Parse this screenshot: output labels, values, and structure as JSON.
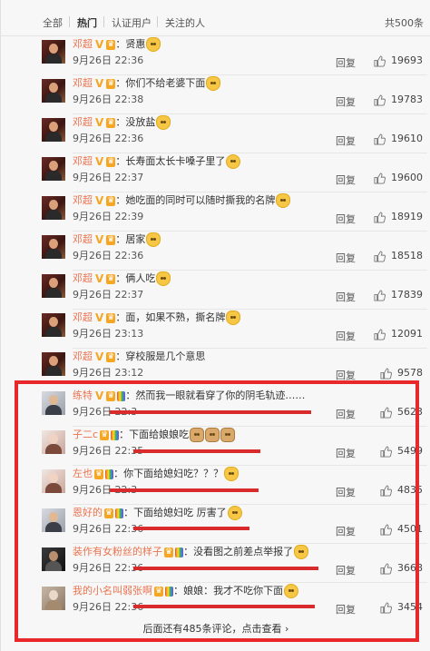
{
  "tabs": {
    "all": "全部",
    "hot": "热门",
    "verified": "认证用户",
    "following": "关注的人",
    "total": "共500条"
  },
  "comments": [
    {
      "user": "邓超",
      "text": "：贤惠",
      "date": "9月26日 22:36",
      "reply": "回复",
      "likes": "19693"
    },
    {
      "user": "邓超",
      "text": "：你们不给老婆下面",
      "date": "9月26日 22:38",
      "reply": "回复",
      "likes": "19783"
    },
    {
      "user": "邓超",
      "text": "：没放盐",
      "date": "9月26日 22:36",
      "reply": "回复",
      "likes": "19610"
    },
    {
      "user": "邓超",
      "text": "：长寿面太长卡嗓子里了",
      "date": "9月26日 22:37",
      "reply": "回复",
      "likes": "19600"
    },
    {
      "user": "邓超",
      "text": "：她吃面的同时可以随时撕我的名牌",
      "date": "9月26日 22:39",
      "reply": "回复",
      "likes": "18919"
    },
    {
      "user": "邓超",
      "text": "：居家",
      "date": "9月26日 22:36",
      "reply": "回复",
      "likes": "18518"
    },
    {
      "user": "邓超",
      "text": "：俩人吃",
      "date": "9月26日 22:37",
      "reply": "回复",
      "likes": "17839"
    },
    {
      "user": "邓超",
      "text": "：面，如果不熟，撕名牌",
      "date": "9月26日 23:13",
      "reply": "回复",
      "likes": "12091"
    },
    {
      "user": "邓超",
      "text": "：穿校服是几个意思",
      "date": "9月26日 23:12",
      "reply": "回复",
      "likes": "9578"
    },
    {
      "user": "练特",
      "text": "：然而我一眼就看穿了你的阴毛轨迹……",
      "date": "9月26日 22:3",
      "reply": "回复",
      "likes": "5623"
    },
    {
      "user": "子二c",
      "text": "：下面给娘娘吃",
      "date": "9月26日 22:35",
      "reply": "回复",
      "likes": "5499"
    },
    {
      "user": "左也",
      "text": "：你下面给媳妇吃？？？",
      "date": "9月26日 22:3",
      "reply": "回复",
      "likes": "4835"
    },
    {
      "user": "恩好的",
      "text": "：下面给媳妇吃 厉害了",
      "date": "9月26日 22:36",
      "reply": "回复",
      "likes": "4501"
    },
    {
      "user": "装作有女粉丝的样子",
      "text": "：没看图之前差点举报了",
      "date": "9月26日 22:36",
      "reply": "回复",
      "likes": "3668"
    },
    {
      "user": "我的小名叫弱张啊",
      "text": "：娘娘：我才不吃你下面",
      "date": "9月26日 22:36",
      "reply": "回复",
      "likes": "3454"
    }
  ],
  "more_link": "后面还有485条评论，点击查看 ›",
  "colors": {
    "username": "#eb7350",
    "highlight": "#e8282b",
    "redaction": "#d92b2b"
  }
}
